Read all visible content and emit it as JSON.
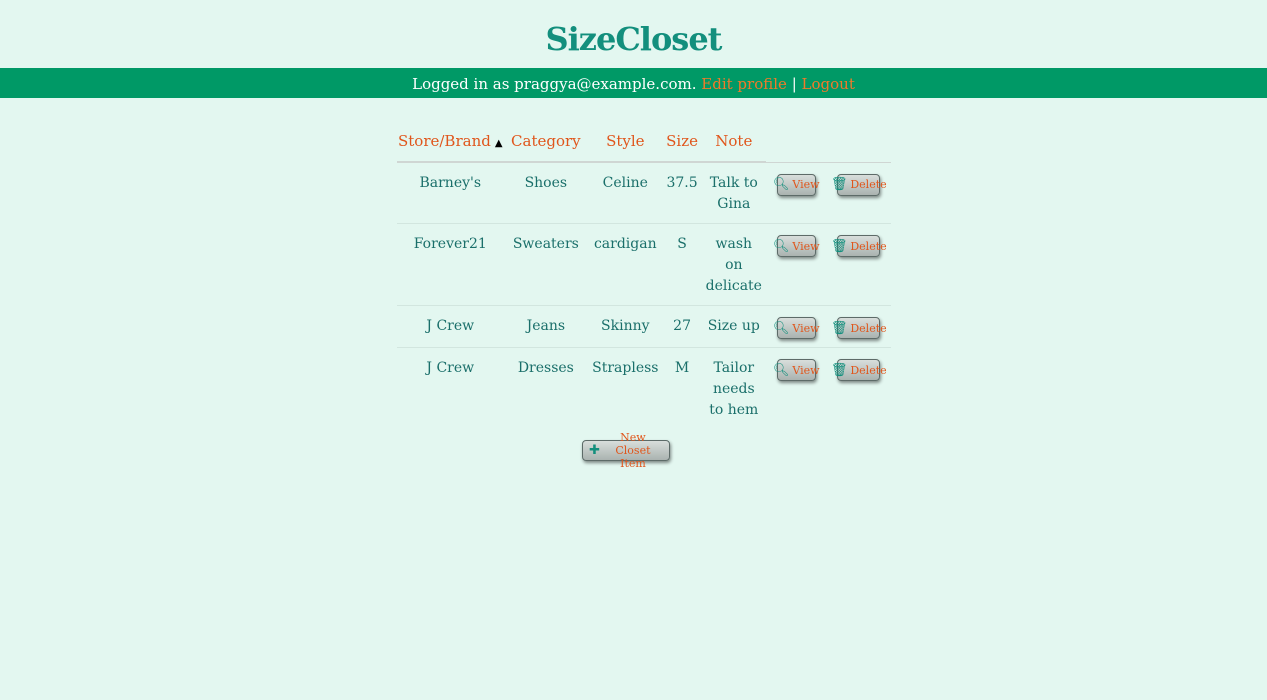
{
  "site": {
    "title": "SizeCloset"
  },
  "login": {
    "prefix": "Logged in as praggya@example.com.",
    "edit_profile": "Edit profile",
    "separator": "|",
    "logout": "Logout"
  },
  "table": {
    "headers": {
      "store": "Store/Brand",
      "sort_indicator": "▲",
      "category": "Category",
      "style": "Style",
      "size": "Size",
      "note": "Note"
    },
    "rows": [
      {
        "store": "Barney's",
        "category": "Shoes",
        "style": "Celine",
        "size": "37.5",
        "note": "Talk to Gina"
      },
      {
        "store": "Forever21",
        "category": "Sweaters",
        "style": "cardigan",
        "size": "S",
        "note": "wash on delicate"
      },
      {
        "store": "J Crew",
        "category": "Jeans",
        "style": "Skinny",
        "size": "27",
        "note": "Size up"
      },
      {
        "store": "J Crew",
        "category": "Dresses",
        "style": "Strapless",
        "size": "M",
        "note": "Tailor needs to hem"
      }
    ],
    "view_label": "View",
    "delete_label": "Delete"
  },
  "new_item_label": "New Closet Item",
  "icons": {
    "view": "search-icon",
    "delete": "trash-icon",
    "new": "plus-icon"
  },
  "colors": {
    "background": "#e3f7f0",
    "bar": "#009966",
    "accent": "#e0561c",
    "text": "#1a6f6a"
  }
}
